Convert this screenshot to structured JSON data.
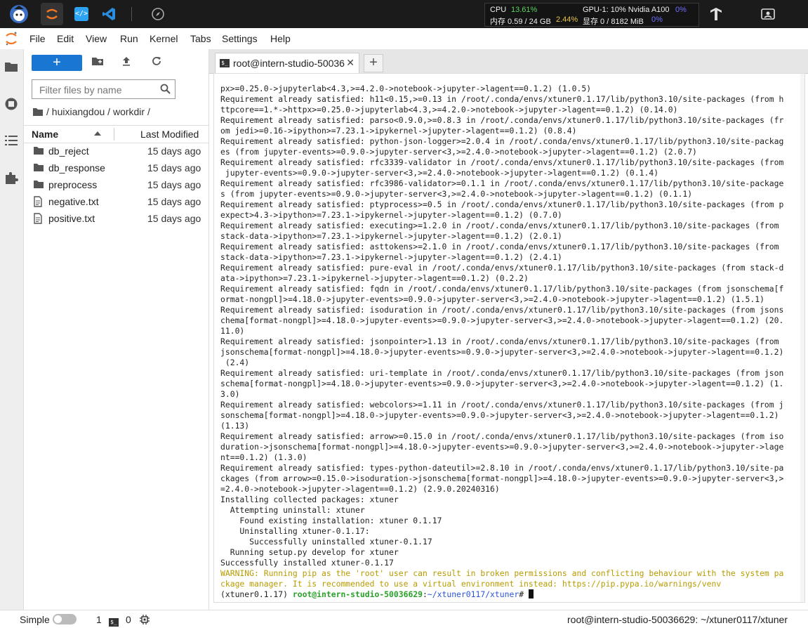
{
  "topbar": {
    "cpu_label": "CPU",
    "cpu_value": "13.61%",
    "mem_label": "内存 0.59 / 24 GB",
    "mem_value": "2.44%",
    "gpu_label": "GPU-1: 10% Nvidia A100",
    "gpu_value": "0%",
    "vram_label": "显存 0 / 8182 MiB",
    "vram_value": "0%"
  },
  "menu": [
    "File",
    "Edit",
    "View",
    "Run",
    "Kernel",
    "Tabs",
    "Settings",
    "Help"
  ],
  "filebrowser": {
    "new_label": "+",
    "filter_placeholder": "Filter files by name",
    "breadcrumb": "/ huixiangdou / workdir /",
    "col_name": "Name",
    "col_modified": "Last Modified",
    "items": [
      {
        "name": "db_reject",
        "modified": "15 days ago",
        "type": "folder"
      },
      {
        "name": "db_response",
        "modified": "15 days ago",
        "type": "folder"
      },
      {
        "name": "preprocess",
        "modified": "15 days ago",
        "type": "folder"
      },
      {
        "name": "negative.txt",
        "modified": "15 days ago",
        "type": "file"
      },
      {
        "name": "positive.txt",
        "modified": "15 days ago",
        "type": "file"
      }
    ]
  },
  "tab": {
    "label": "root@intern-studio-50036",
    "close": "✕",
    "add": "+"
  },
  "terminal": {
    "lines": [
      "px>=0.25.0->jupyterlab<4.3,>=4.2.0->notebook->jupyter->lagent==0.1.2) (1.0.5)",
      "Requirement already satisfied: h11<0.15,>=0.13 in /root/.conda/envs/xtuner0.1.17/lib/python3.10/site-packages (from h",
      "ttpcore==1.*->httpx>=0.25.0->jupyterlab<4.3,>=4.2.0->notebook->jupyter->lagent==0.1.2) (0.14.0)",
      "Requirement already satisfied: parso<0.9.0,>=0.8.3 in /root/.conda/envs/xtuner0.1.17/lib/python3.10/site-packages (fr",
      "om jedi>=0.16->ipython>=7.23.1->ipykernel->jupyter->lagent==0.1.2) (0.8.4)",
      "Requirement already satisfied: python-json-logger>=2.0.4 in /root/.conda/envs/xtuner0.1.17/lib/python3.10/site-packag",
      "es (from jupyter-events>=0.9.0->jupyter-server<3,>=2.4.0->notebook->jupyter->lagent==0.1.2) (2.0.7)",
      "Requirement already satisfied: rfc3339-validator in /root/.conda/envs/xtuner0.1.17/lib/python3.10/site-packages (from",
      " jupyter-events>=0.9.0->jupyter-server<3,>=2.4.0->notebook->jupyter->lagent==0.1.2) (0.1.4)",
      "Requirement already satisfied: rfc3986-validator>=0.1.1 in /root/.conda/envs/xtuner0.1.17/lib/python3.10/site-package",
      "s (from jupyter-events>=0.9.0->jupyter-server<3,>=2.4.0->notebook->jupyter->lagent==0.1.2) (0.1.1)",
      "Requirement already satisfied: ptyprocess>=0.5 in /root/.conda/envs/xtuner0.1.17/lib/python3.10/site-packages (from p",
      "expect>4.3->ipython>=7.23.1->ipykernel->jupyter->lagent==0.1.2) (0.7.0)",
      "Requirement already satisfied: executing>=1.2.0 in /root/.conda/envs/xtuner0.1.17/lib/python3.10/site-packages (from",
      "stack-data->ipython>=7.23.1->ipykernel->jupyter->lagent==0.1.2) (2.0.1)",
      "Requirement already satisfied: asttokens>=2.1.0 in /root/.conda/envs/xtuner0.1.17/lib/python3.10/site-packages (from",
      "stack-data->ipython>=7.23.1->ipykernel->jupyter->lagent==0.1.2) (2.4.1)",
      "Requirement already satisfied: pure-eval in /root/.conda/envs/xtuner0.1.17/lib/python3.10/site-packages (from stack-d",
      "ata->ipython>=7.23.1->ipykernel->jupyter->lagent==0.1.2) (0.2.2)",
      "Requirement already satisfied: fqdn in /root/.conda/envs/xtuner0.1.17/lib/python3.10/site-packages (from jsonschema[f",
      "ormat-nongpl]>=4.18.0->jupyter-events>=0.9.0->jupyter-server<3,>=2.4.0->notebook->jupyter->lagent==0.1.2) (1.5.1)",
      "Requirement already satisfied: isoduration in /root/.conda/envs/xtuner0.1.17/lib/python3.10/site-packages (from jsons",
      "chema[format-nongpl]>=4.18.0->jupyter-events>=0.9.0->jupyter-server<3,>=2.4.0->notebook->jupyter->lagent==0.1.2) (20.",
      "11.0)",
      "Requirement already satisfied: jsonpointer>1.13 in /root/.conda/envs/xtuner0.1.17/lib/python3.10/site-packages (from",
      "jsonschema[format-nongpl]>=4.18.0->jupyter-events>=0.9.0->jupyter-server<3,>=2.4.0->notebook->jupyter->lagent==0.1.2)",
      " (2.4)",
      "Requirement already satisfied: uri-template in /root/.conda/envs/xtuner0.1.17/lib/python3.10/site-packages (from json",
      "schema[format-nongpl]>=4.18.0->jupyter-events>=0.9.0->jupyter-server<3,>=2.4.0->notebook->jupyter->lagent==0.1.2) (1.",
      "3.0)",
      "Requirement already satisfied: webcolors>=1.11 in /root/.conda/envs/xtuner0.1.17/lib/python3.10/site-packages (from j",
      "sonschema[format-nongpl]>=4.18.0->jupyter-events>=0.9.0->jupyter-server<3,>=2.4.0->notebook->jupyter->lagent==0.1.2)",
      "(1.13)",
      "Requirement already satisfied: arrow>=0.15.0 in /root/.conda/envs/xtuner0.1.17/lib/python3.10/site-packages (from iso",
      "duration->jsonschema[format-nongpl]>=4.18.0->jupyter-events>=0.9.0->jupyter-server<3,>=2.4.0->notebook->jupyter->lage",
      "nt==0.1.2) (1.3.0)",
      "Requirement already satisfied: types-python-dateutil>=2.8.10 in /root/.conda/envs/xtuner0.1.17/lib/python3.10/site-pa",
      "ckages (from arrow>=0.15.0->isoduration->jsonschema[format-nongpl]>=4.18.0->jupyter-events>=0.9.0->jupyter-server<3,>",
      "=2.4.0->notebook->jupyter->lagent==0.1.2) (2.9.0.20240316)",
      "Installing collected packages: xtuner",
      "  Attempting uninstall: xtuner",
      "    Found existing installation: xtuner 0.1.17",
      "    Uninstalling xtuner-0.1.17:",
      "      Successfully uninstalled xtuner-0.1.17",
      "  Running setup.py develop for xtuner",
      "Successfully installed xtuner-0.1.17"
    ],
    "warning_lines": [
      "WARNING: Running pip as the 'root' user can result in broken permissions and conflicting behaviour with the system pa",
      "ckage manager. It is recommended to use a virtual environment instead: https://pip.pypa.io/warnings/venv"
    ],
    "prompt_env": "(xtuner0.1.17) ",
    "prompt_host": "root@intern-studio-50036629",
    "prompt_sep": ":",
    "prompt_path": "~/xtuner0117/xtuner",
    "prompt_end": "# "
  },
  "statusbar": {
    "mode": "Simple",
    "count1": "1",
    "count2": "0",
    "right": "root@intern-studio-50036629: ~/xtuner0117/xtuner"
  },
  "colors": {
    "accent": "#1976d2",
    "warning": "#b89b00",
    "prompt_green": "#2aa12a",
    "prompt_blue": "#2b55d6"
  }
}
